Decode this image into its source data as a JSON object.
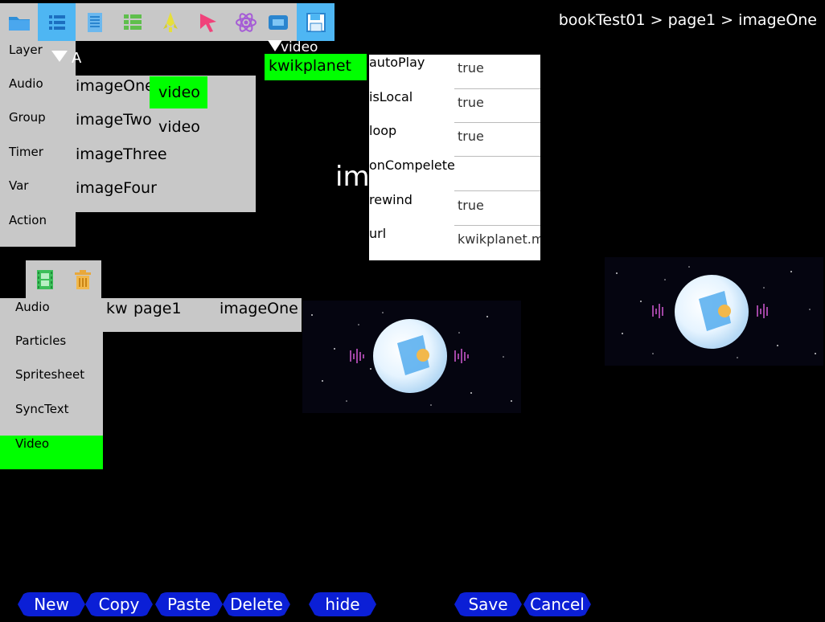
{
  "breadcrumb": "bookTest01 > page1 > imageOne",
  "toolbar": {
    "icons": [
      "folder-icon",
      "list-icon",
      "document-icon",
      "table-icon",
      "rocket-icon",
      "cursor-icon",
      "atom-icon",
      "component-icon",
      "save-icon"
    ]
  },
  "layer_menu": {
    "items": [
      "Layer",
      "Audio",
      "Group",
      "Timer",
      "Var",
      "Action"
    ],
    "a_label": "A"
  },
  "layer_list": {
    "items": [
      "imageOne",
      "imageTwo",
      "imageThree",
      "imageFour"
    ]
  },
  "video_column": {
    "selected": "video",
    "second": "video"
  },
  "top_video": {
    "label": "video",
    "selected": "kwikplanet"
  },
  "properties": [
    {
      "key": "autoPlay",
      "value": "true"
    },
    {
      "key": "isLocal",
      "value": "true"
    },
    {
      "key": "loop",
      "value": "true"
    },
    {
      "key": "onCompelete",
      "value": ""
    },
    {
      "key": "rewind",
      "value": "true"
    },
    {
      "key": "url",
      "value": "kwikplanet.m"
    }
  ],
  "canvas_text": "ima",
  "small_toolbar": {
    "icons": [
      "film-icon",
      "trash-icon"
    ]
  },
  "add_menu": {
    "items": [
      "Audio",
      "Particles",
      "Spritesheet",
      "SyncText",
      "Video"
    ],
    "selected_index": 4
  },
  "path_bar": {
    "book": "kw",
    "page": "page1",
    "layer": "imageOne"
  },
  "buttons": {
    "new": "New",
    "copy": "Copy",
    "paste": "Paste",
    "delete": "Delete",
    "hide": "hide",
    "save": "Save",
    "cancel": "Cancel"
  },
  "colors": {
    "selected": "#00ff00",
    "active_tool": "#4eb6f3",
    "panel": "#c8c8c8",
    "button": "#0b1fd6"
  }
}
